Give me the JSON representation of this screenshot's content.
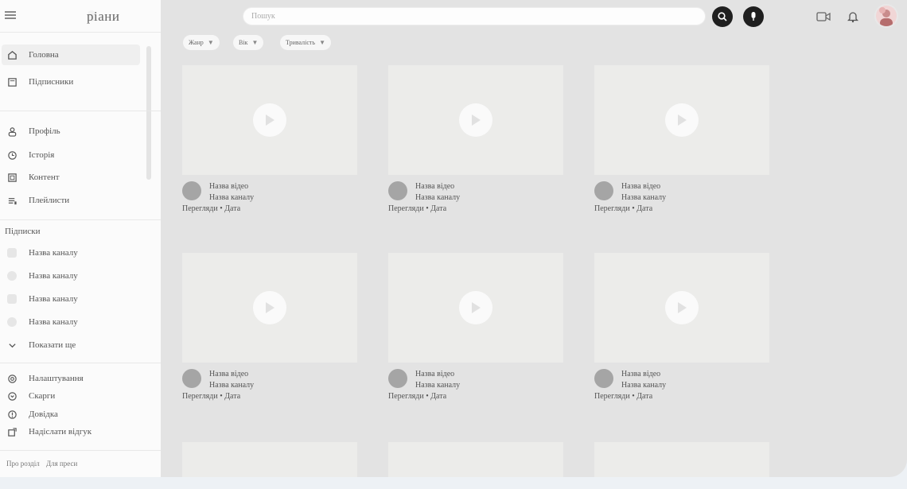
{
  "app": {
    "logo": "pіани"
  },
  "sidebar": {
    "primary": [
      {
        "label": "Головна",
        "icon": "home-icon"
      },
      {
        "label": "Підписники",
        "icon": "subscriptions-icon"
      }
    ],
    "personal": [
      {
        "label": "Профіль",
        "icon": "profile-icon"
      },
      {
        "label": "Історія",
        "icon": "history-icon"
      },
      {
        "label": "Контент",
        "icon": "content-icon"
      },
      {
        "label": "Плейлисти",
        "icon": "playlist-icon"
      }
    ],
    "subscriptions_heading": "Підписки",
    "subscriptions": [
      {
        "label": "Назва каналу"
      },
      {
        "label": "Назва каналу"
      },
      {
        "label": "Назва каналу"
      },
      {
        "label": "Назва каналу"
      }
    ],
    "show_more": "Показати ще",
    "settings": [
      {
        "label": "Налаштування",
        "icon": "settings-icon"
      },
      {
        "label": "Скарги",
        "icon": "report-icon"
      },
      {
        "label": "Довідка",
        "icon": "help-icon"
      },
      {
        "label": "Надіслати відгук",
        "icon": "feedback-icon"
      }
    ],
    "footer": [
      "Про розділ",
      "Для преси"
    ]
  },
  "search": {
    "placeholder": "Пошук"
  },
  "filters": [
    {
      "label": "Жанр"
    },
    {
      "label": "Вік"
    },
    {
      "label": "Тривалість"
    }
  ],
  "videos": [
    {
      "title": "Назва відео",
      "channel": "Назва каналу",
      "stats": "Перегляди • Дата"
    },
    {
      "title": "Назва відео",
      "channel": "Назва каналу",
      "stats": "Перегляди • Дата"
    },
    {
      "title": "Назва відео",
      "channel": "Назва каналу",
      "stats": "Перегляди • Дата"
    },
    {
      "title": "Назва відео",
      "channel": "Назва каналу",
      "stats": "Перегляди • Дата"
    },
    {
      "title": "Назва відео",
      "channel": "Назва каналу",
      "stats": "Перегляди • Дата"
    },
    {
      "title": "Назва відео",
      "channel": "Назва каналу",
      "stats": "Перегляди • Дата"
    }
  ],
  "colors": {
    "sidebar_bg": "#fbfbfb",
    "main_bg": "#e3e3e3",
    "thumb_bg": "#ececea",
    "accent_dark": "#1f1f1f"
  }
}
